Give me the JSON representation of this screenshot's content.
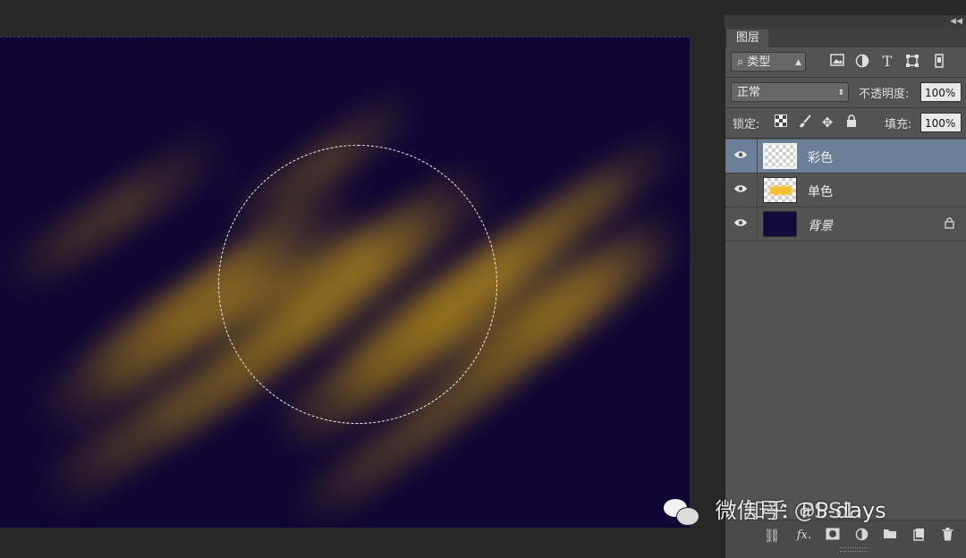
{
  "layers_panel": {
    "tab_label": "图层",
    "collapse_icon": "double-chevron-left-icon",
    "filter": {
      "value": "类型",
      "icon": "search-icon"
    },
    "filter_icons": [
      "image-filter-icon",
      "adjustment-filter-icon",
      "type-filter-icon",
      "shape-filter-icon",
      "smart-object-filter-icon"
    ],
    "blend_mode": "正常",
    "opacity": {
      "label": "不透明度:",
      "value": "100%"
    },
    "lock": {
      "label": "锁定:",
      "icons": [
        "lock-transparent-icon",
        "lock-image-icon",
        "lock-position-icon",
        "lock-all-icon"
      ]
    },
    "fill": {
      "label": "填充:",
      "value": "100%"
    },
    "layers": [
      {
        "name": "彩色",
        "visible": true,
        "selected": true,
        "locked": false
      },
      {
        "name": "单色",
        "visible": true,
        "selected": false,
        "locked": false
      },
      {
        "name": "背景",
        "visible": true,
        "selected": false,
        "locked": true
      }
    ],
    "bottom_icons": [
      "link-layers-icon",
      "fx-icon",
      "add-mask-icon",
      "new-adjustment-icon",
      "new-group-icon",
      "new-layer-icon",
      "delete-icon"
    ]
  },
  "colors": {
    "canvas_bg": "#100634",
    "glow": "#a8801f",
    "panel_bg": "#535353",
    "selected_layer": "#6c7f99"
  },
  "watermark": {
    "text": "微信号：PS-days",
    "overlay_text": "知乎 @PS1"
  }
}
